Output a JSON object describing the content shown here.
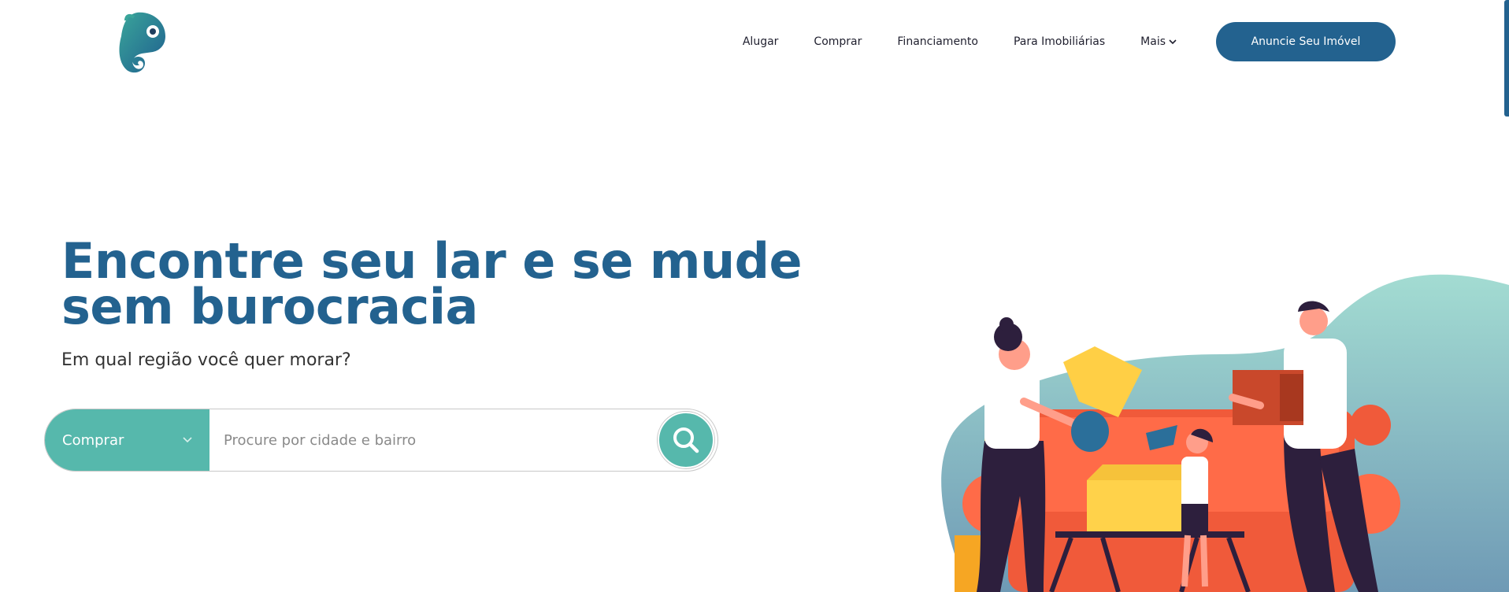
{
  "header": {
    "logo_icon": "chameleon-logo",
    "nav": {
      "items": [
        {
          "label": "Alugar"
        },
        {
          "label": "Comprar"
        },
        {
          "label": "Financiamento"
        },
        {
          "label": "Para Imobiliárias"
        },
        {
          "label": "Mais",
          "icon": "chevron-down-icon"
        }
      ],
      "cta_label": "Anuncie Seu Imóvel"
    }
  },
  "hero": {
    "title": "Encontre seu lar e se mude sem burocracia",
    "subtitle": "Em qual região você quer morar?",
    "illustration": "family-moving-furniture-illustration"
  },
  "search": {
    "mode_selected": "Comprar",
    "placeholder": "Procure por cidade e bairro",
    "button_icon": "search-icon"
  },
  "colors": {
    "brand_blue": "#23628f",
    "accent_teal": "#56b8ac",
    "blob_teal": "#9ed8cf",
    "sofa_orange": "#f45c3e"
  }
}
